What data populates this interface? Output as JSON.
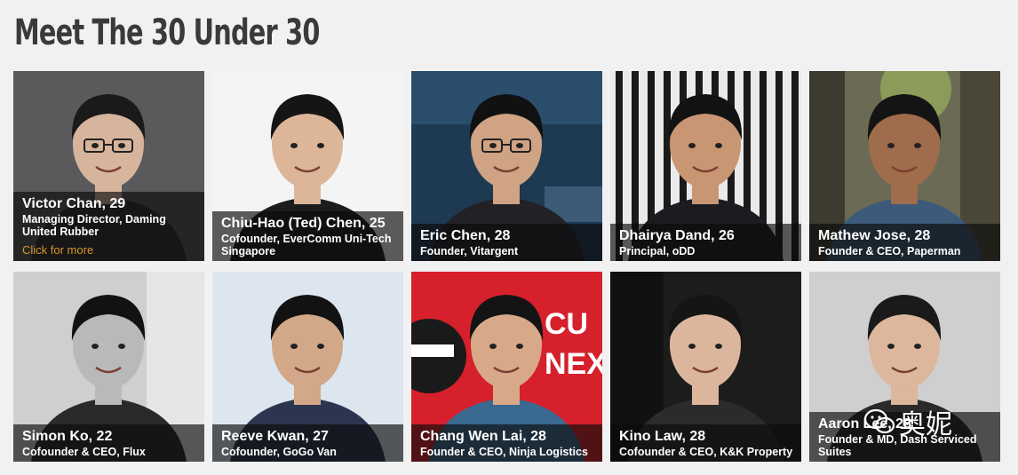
{
  "page": {
    "title": "Meet The 30 Under 30",
    "background": "#f1f1f1"
  },
  "cards": [
    {
      "name": "Victor Chan, 29",
      "role": "Managing Director, Daming United Rubber",
      "link": "Click for more",
      "bg": "#5a5a5c",
      "skin": "#d7b49c",
      "hair": "#1a1a1a",
      "shirt": "#2c2c2e",
      "glasses": true,
      "backdrop": "plain"
    },
    {
      "name": "Chiu-Hao (Ted) Chen, 25",
      "role": "Cofounder, EverComm Uni-Tech Singapore",
      "bg": "#f4f4f4",
      "skin": "#ddb699",
      "hair": "#151515",
      "shirt": "#1c1c1c",
      "glasses": false,
      "backdrop": "plain"
    },
    {
      "name": "Eric Chen, 28",
      "role": "Founder, Vitargent",
      "bg": "#1e3a52",
      "skin": "#cfa384",
      "hair": "#111111",
      "shirt": "#222226",
      "glasses": true,
      "backdrop": "banner"
    },
    {
      "name": "Dhairya Dand, 26",
      "role": "Principal, oDD",
      "bg": "#eaeaea",
      "skin": "#c99673",
      "hair": "#121212",
      "shirt": "#1c1c20",
      "glasses": false,
      "backdrop": "stripes"
    },
    {
      "name": "Mathew Jose, 28",
      "role": "Founder & CEO, Paperman",
      "bg": "#6b6a55",
      "skin": "#9f6c4c",
      "hair": "#141414",
      "shirt": "#3d5a7a",
      "glasses": false,
      "backdrop": "trees"
    },
    {
      "name": "Simon Ko, 22",
      "role": "Cofounder & CEO, Flux",
      "bg": "#cfcfcf",
      "skin": "#b9b9b9",
      "hair": "#121212",
      "shirt": "#2a2a2a",
      "glasses": false,
      "backdrop": "bw"
    },
    {
      "name": "Reeve Kwan, 27",
      "role": "Cofounder, GoGo Van",
      "bg": "#dde6ef",
      "skin": "#d2a888",
      "hair": "#121212",
      "shirt": "#2c3550",
      "glasses": false,
      "backdrop": "plain"
    },
    {
      "name": "Chang Wen Lai, 28",
      "role": "Founder & CEO, Ninja Logistics",
      "bg": "#d6202b",
      "skin": "#d8a988",
      "hair": "#141414",
      "shirt": "#3b6a90",
      "glasses": false,
      "backdrop": "ninja",
      "sign_text": "CU NEX"
    },
    {
      "name": "Kino Law, 28",
      "role": "Cofounder & CEO, K&K Property",
      "bg": "#1c1c1c",
      "skin": "#dcb69c",
      "hair": "#151515",
      "shirt": "#2b2b2b",
      "glasses": false,
      "backdrop": "dark"
    },
    {
      "name": "Aaron Lee, 28",
      "role": "Founder & MD, Dash Serviced Suites",
      "bg": "#cfcfcf",
      "skin": "#dcb79c",
      "hair": "#1a1a1a",
      "shirt": "#2a2a2a",
      "glasses": false,
      "backdrop": "plain"
    }
  ],
  "watermark": {
    "text": "奥妮"
  }
}
